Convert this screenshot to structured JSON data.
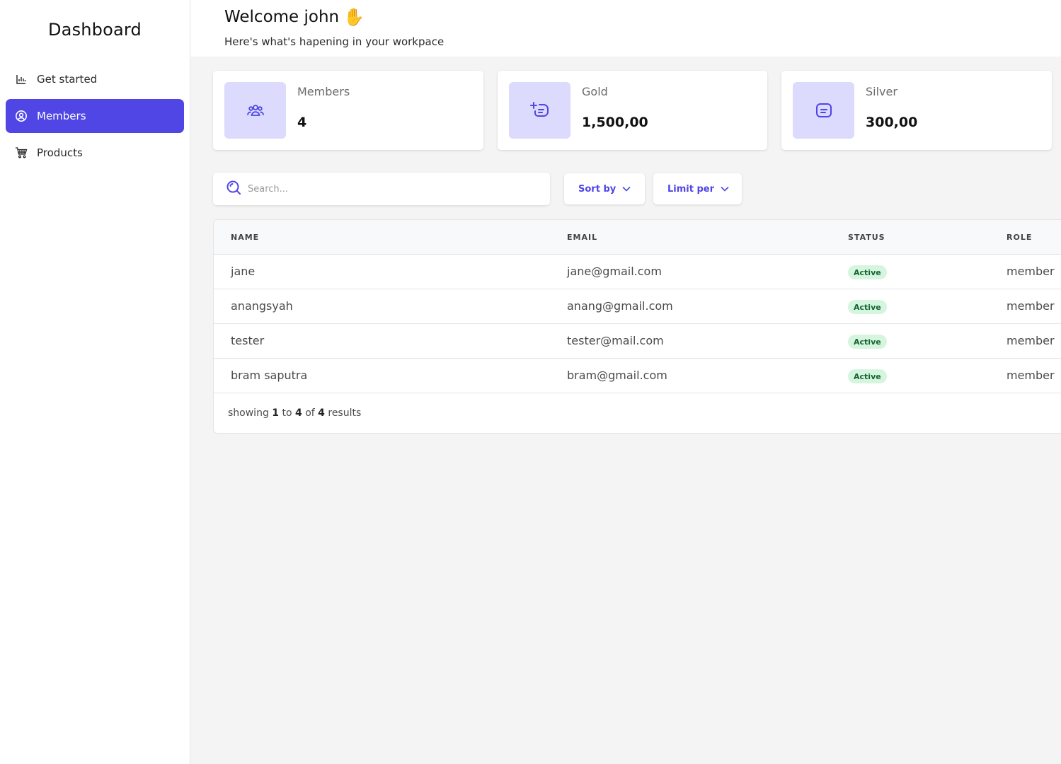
{
  "sidebar": {
    "brand": "Dashboard",
    "items": [
      {
        "label": "Get started",
        "icon": "bar-chart-icon",
        "active": false
      },
      {
        "label": "Members",
        "icon": "user-circle-icon",
        "active": true
      },
      {
        "label": "Products",
        "icon": "cart-icon",
        "active": false
      }
    ]
  },
  "header": {
    "welcome": "Welcome john",
    "emoji": "✋",
    "subtitle": "Here's what's hapening in your workpace"
  },
  "stats": [
    {
      "label": "Members",
      "value": "4",
      "icon": "users-icon"
    },
    {
      "label": "Gold",
      "value": "1,500,00",
      "icon": "add-note-icon"
    },
    {
      "label": "Silver",
      "value": "300,00",
      "icon": "note-icon"
    }
  ],
  "toolbar": {
    "search_placeholder": "Search...",
    "sort_label": "Sort by",
    "limit_label": "Limit per"
  },
  "table": {
    "columns": [
      "NAME",
      "EMAIL",
      "STATUS",
      "ROLE"
    ],
    "rows": [
      {
        "name": "jane",
        "email": "jane@gmail.com",
        "status": "Active",
        "role": "member"
      },
      {
        "name": "anangsyah",
        "email": "anang@gmail.com",
        "status": "Active",
        "role": "member"
      },
      {
        "name": "tester",
        "email": "tester@mail.com",
        "status": "Active",
        "role": "member"
      },
      {
        "name": "bram saputra",
        "email": "bram@gmail.com",
        "status": "Active",
        "role": "member"
      }
    ],
    "footer": {
      "prefix": "showing",
      "from": "1",
      "to_word": "to",
      "to": "4",
      "of_word": "of",
      "total": "4",
      "suffix": "results"
    }
  },
  "colors": {
    "accent": "#4f46e5",
    "icon_bg": "#dcdafd",
    "badge_bg": "#d6f5df",
    "badge_text": "#166534"
  }
}
